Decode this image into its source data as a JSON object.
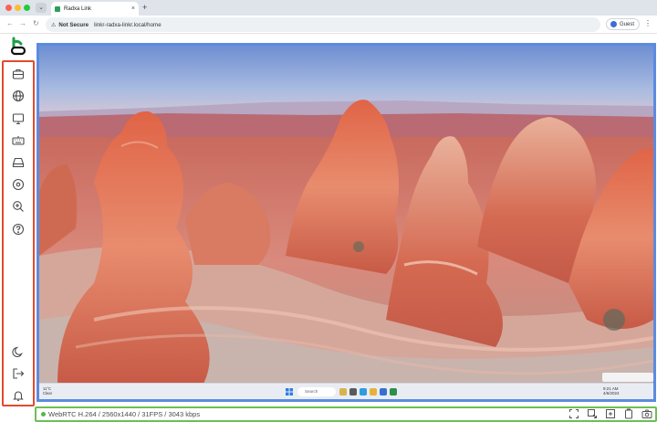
{
  "browser": {
    "tab_title": "Radxa Link",
    "tab_close": "×",
    "new_tab": "+",
    "security_label": "Not Secure",
    "url": "linkr-radxa-linkr.local/home",
    "profile_label": "Guest",
    "menu_glyph": "⋮",
    "back_glyph": "←",
    "forward_glyph": "→",
    "reload_glyph": "↻",
    "dropdown_glyph": "⌄"
  },
  "app": {
    "brand_color": "#1e9e4a",
    "sidebar_border_color": "#e24a2e",
    "video_border_color": "#5b8be0",
    "status_border_color": "#6dbf55"
  },
  "sidebar": {
    "top_icons": [
      "toolbox-icon",
      "globe-icon",
      "monitor-icon",
      "keyboard-icon",
      "drive-icon",
      "disc-icon",
      "zoom-icon",
      "help-icon"
    ],
    "bottom_icons": [
      "moon-icon",
      "logout-icon",
      "bell-icon"
    ]
  },
  "remote_desktop": {
    "search_placeholder": "Search",
    "weather_temp": "11°C",
    "weather_desc": "Clear",
    "clock_time": "9:21 AM",
    "clock_date": "4/6/2024"
  },
  "status": {
    "stream_info": "WebRTC H.264 / 2560x1440 / 31FPS / 3043 kbps",
    "buttons": [
      "fullscreen-icon",
      "screenshot-icon",
      "paste-icon",
      "clipboard-icon",
      "camera-icon"
    ]
  }
}
